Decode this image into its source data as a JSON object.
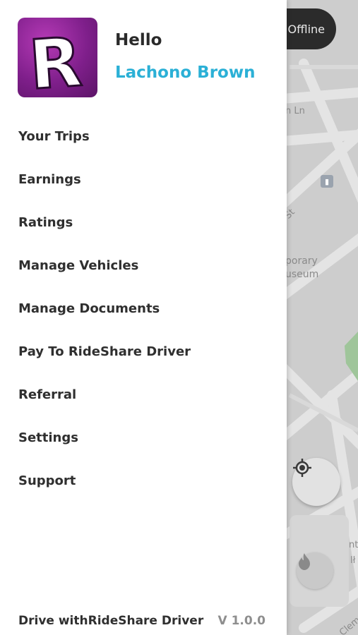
{
  "status": {
    "label": "Offline"
  },
  "map": {
    "labels": {
      "street_ln": "n Ln",
      "street_st": "St",
      "museum_line1": "porary",
      "museum_line2": "useum",
      "right_1": "nta",
      "right_2": "lł",
      "right_3": "Cleme"
    }
  },
  "profile": {
    "greeting": "Hello",
    "name": "Lachono Brown",
    "avatar_letter": "R"
  },
  "menu": {
    "items": [
      {
        "label": "Your Trips"
      },
      {
        "label": "Earnings"
      },
      {
        "label": "Ratings"
      },
      {
        "label": "Manage Vehicles"
      },
      {
        "label": "Manage Documents"
      },
      {
        "label": "Pay To RideShare Driver"
      },
      {
        "label": "Referral"
      },
      {
        "label": "Settings"
      },
      {
        "label": "Support"
      }
    ]
  },
  "footer": {
    "brand": "Drive withRideShare Driver",
    "version": "V 1.0.0"
  },
  "colors": {
    "accent": "#2bb0d6",
    "avatar": "#8e2a9c",
    "pill": "#2b2b2b"
  }
}
